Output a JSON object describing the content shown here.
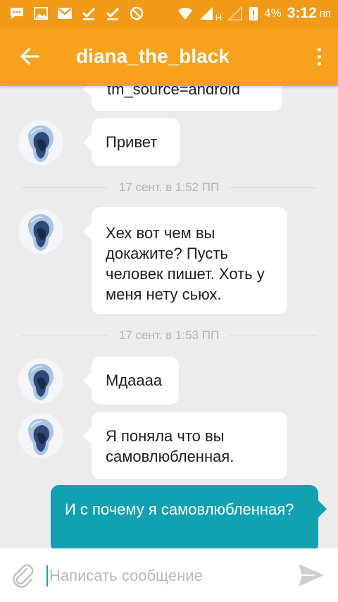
{
  "status_bar": {
    "battery_level": "4%",
    "time": "3:12",
    "time_suffix": "пп",
    "network_type": "H"
  },
  "app_bar": {
    "title": "diana_the_black"
  },
  "messages": [
    {
      "type": "incoming",
      "text": "tm_source=android"
    },
    {
      "type": "incoming",
      "text": "Привет"
    },
    {
      "type": "date",
      "text": "17 сент. в 1:52 ПП"
    },
    {
      "type": "incoming",
      "text": "Хех вот чем вы докажите? Пусть человек пишет. Хоть у меня нету сьюх."
    },
    {
      "type": "date",
      "text": "17 сент. в 1:53 ПП"
    },
    {
      "type": "incoming",
      "text": "Мдаааа"
    },
    {
      "type": "incoming",
      "text": "Я поняла что вы самовлюбленная."
    },
    {
      "type": "outgoing",
      "text": "И с почему я самовлюбленная?"
    }
  ],
  "composer": {
    "placeholder": "Написать сообщение",
    "value": ""
  },
  "colors": {
    "accent": "#f7a11c",
    "outgoing_bubble": "#12a1b0",
    "background": "#ececec"
  }
}
